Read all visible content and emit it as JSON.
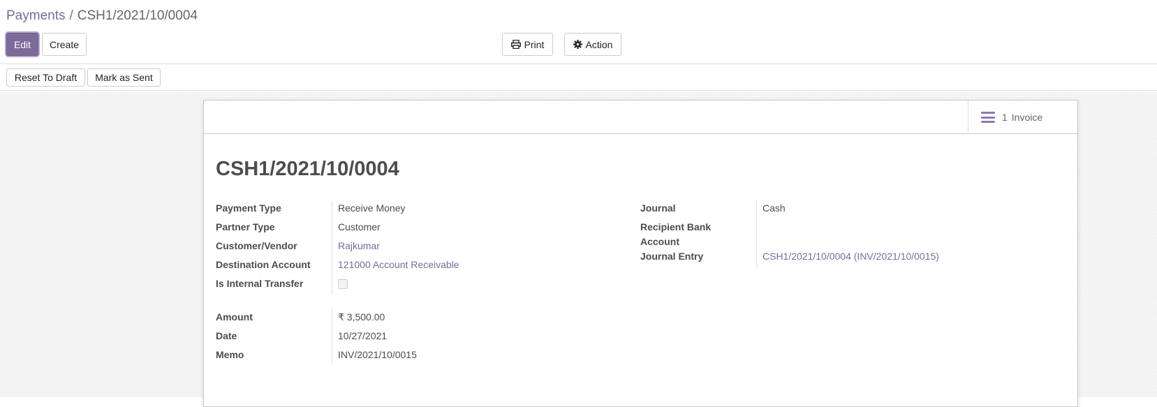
{
  "breadcrumb": {
    "parent": "Payments",
    "separator": "/",
    "current": "CSH1/2021/10/0004"
  },
  "toolbar": {
    "edit_label": "Edit",
    "create_label": "Create",
    "print_label": "Print",
    "action_label": "Action"
  },
  "statusbar": {
    "reset_label": "Reset To Draft",
    "mark_sent_label": "Mark as Sent"
  },
  "smart_button": {
    "count": "1",
    "label": "Invoice",
    "icon": "list-icon"
  },
  "record": {
    "title": "CSH1/2021/10/0004",
    "left_fields": {
      "payment_type": {
        "label": "Payment Type",
        "value": "Receive Money"
      },
      "partner_type": {
        "label": "Partner Type",
        "value": "Customer"
      },
      "customer_vendor": {
        "label": "Customer/Vendor",
        "value": "Rajkumar"
      },
      "destination_account": {
        "label": "Destination Account",
        "value": "121000 Account Receivable"
      },
      "internal_transfer": {
        "label": "Is Internal Transfer",
        "checked": false
      }
    },
    "amount_fields": {
      "amount": {
        "label": "Amount",
        "value": "₹ 3,500.00"
      },
      "date": {
        "label": "Date",
        "value": "10/27/2021"
      },
      "memo": {
        "label": "Memo",
        "value": "INV/2021/10/0015"
      }
    },
    "right_fields": {
      "journal": {
        "label": "Journal",
        "value": "Cash"
      },
      "recipient_bank_line1": "Recipient Bank",
      "recipient_bank_line2": "Account",
      "journal_entry": {
        "label": "Journal Entry",
        "value": "CSH1/2021/10/0004 (INV/2021/10/0015)"
      }
    }
  },
  "colors": {
    "brand": "#7c6a9a",
    "link": "#7c6a9a",
    "text": "#4c4c4c"
  }
}
